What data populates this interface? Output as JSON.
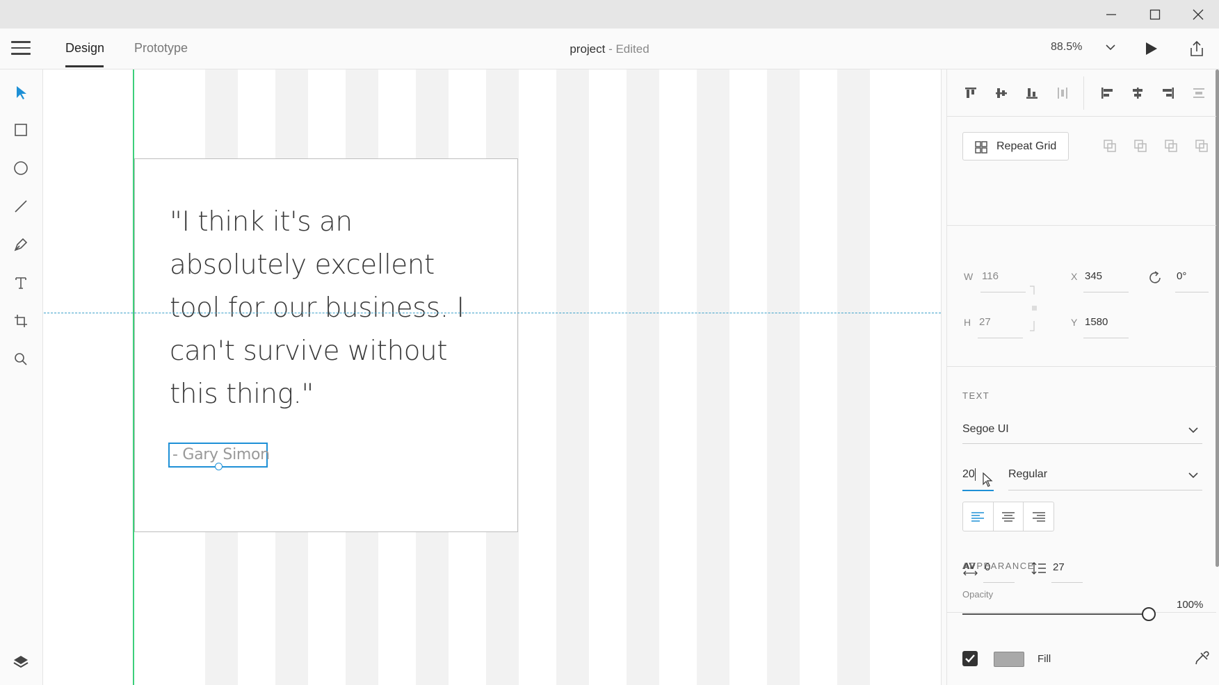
{
  "window": {
    "buttons": [
      "minimize",
      "maximize",
      "close"
    ]
  },
  "toolbar": {
    "tabs": [
      {
        "label": "Design",
        "active": true
      },
      {
        "label": "Prototype",
        "active": false
      }
    ],
    "doc_name": "project",
    "doc_status": " - Edited",
    "zoom": "88.5%"
  },
  "tools": [
    "select-icon",
    "rectangle-icon",
    "ellipse-icon",
    "line-icon",
    "pen-icon",
    "text-icon",
    "artboard-icon",
    "zoom-icon",
    "layers-icon"
  ],
  "artboard": {
    "quote": "\"I think it's an absolutely excellent tool for our business. I can't survive without this thing.\"",
    "author": "- Gary Simon"
  },
  "panel": {
    "repeat_grid_label": "Repeat Grid",
    "transform": {
      "w_label": "W",
      "w": "116",
      "h_label": "H",
      "h": "27",
      "x_label": "X",
      "x": "345",
      "y_label": "Y",
      "y": "1580",
      "rotation": "0°"
    },
    "text": {
      "section_title": "TEXT",
      "font_family": "Segoe UI",
      "font_size": "20",
      "font_weight": "Regular",
      "char_spacing": "0",
      "line_spacing": "27",
      "alignment": "left"
    },
    "appearance": {
      "section_title": "APPEARANCE",
      "opacity_label": "Opacity",
      "opacity": "100%",
      "opacity_fraction": 1.0,
      "fill_label": "Fill",
      "fill_enabled": true,
      "fill_color": "#a9a9a9"
    }
  },
  "colors": {
    "accent": "#1e90d6",
    "guide_green": "#3ccf7a"
  }
}
